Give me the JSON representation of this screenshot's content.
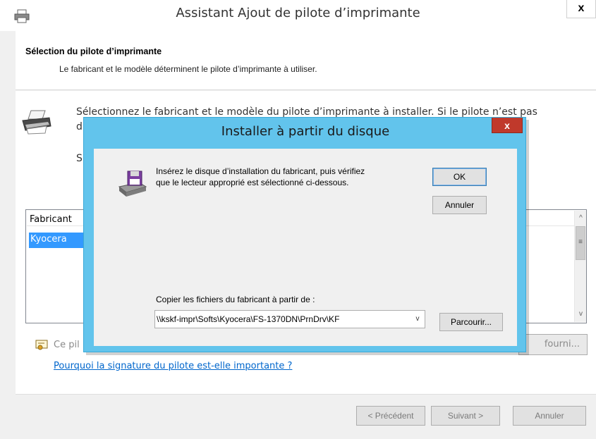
{
  "wizard": {
    "title": "Assistant Ajout de pilote d’imprimante",
    "close_glyph": "x",
    "heading": "Sélection du pilote d’imprimante",
    "subheading": "Le fabricant et le modèle déterminent le pilote d’imprimante à utiliser.",
    "instruction_line1": "Sélectionnez le fabricant et le modèle du pilote d’imprimante à installer. Si le pilote n’est pas",
    "instruction_line2": "d",
    "instruction_line3": "S",
    "manufacturer_list": {
      "header": "Fabricant",
      "items": [
        "Kyocera"
      ],
      "scroll_up": "^",
      "scroll_down": "v",
      "scroll_thumb": "≡"
    },
    "signed_text": "Ce pil",
    "windows_update_button": "fourni...",
    "why_link": "Pourquoi la signature du pilote est-elle importante ?",
    "buttons": {
      "previous": "< Précédent",
      "next": "Suivant >",
      "cancel": "Annuler"
    }
  },
  "dialog": {
    "title": "Installer à partir du disque",
    "close_glyph": "x",
    "message": "Insérez le disque d’installation du fabricant, puis vérifiez que le lecteur approprié est sélectionné ci-dessous.",
    "ok_button": "OK",
    "cancel_button": "Annuler",
    "copy_label": "Copier les fichiers du fabricant à partir de :",
    "path_value": "\\\\kskf-impr\\Softs\\Kyocera\\FS-1370DN\\PrnDrv\\KF",
    "path_arrow": "v",
    "browse_button": "Parcourir..."
  },
  "colors": {
    "dialog_frame": "#62c4ec",
    "close_red": "#c0392b",
    "selection": "#3399ff",
    "link": "#0066cc"
  }
}
